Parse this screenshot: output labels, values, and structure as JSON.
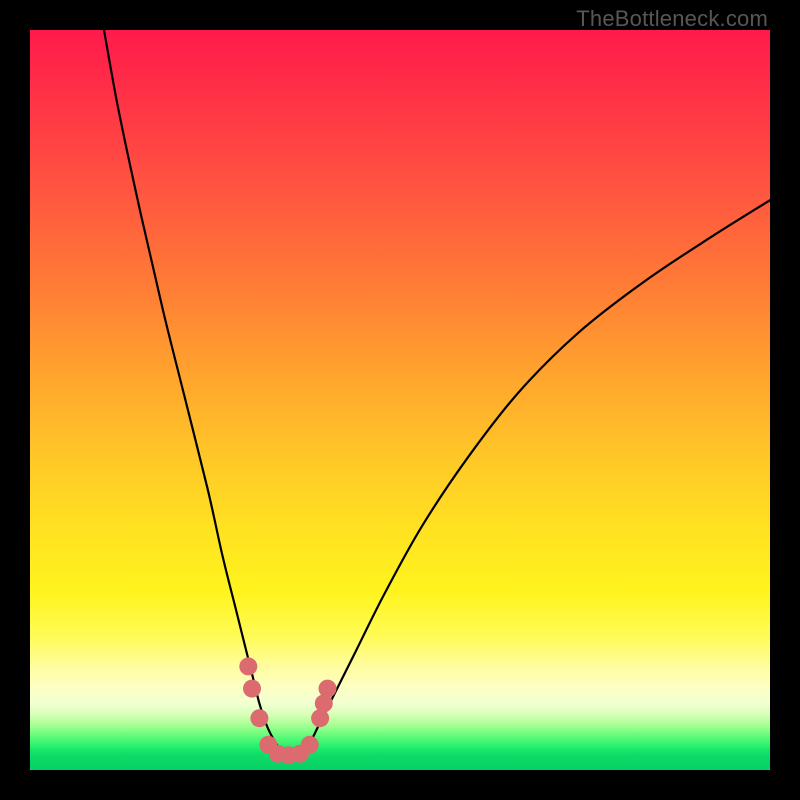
{
  "watermark": "TheBottleneck.com",
  "chart_data": {
    "type": "line",
    "title": "",
    "xlabel": "",
    "ylabel": "",
    "xlim": [
      0,
      100
    ],
    "ylim": [
      0,
      100
    ],
    "series": [
      {
        "name": "curve",
        "x": [
          10,
          12,
          15,
          18,
          21,
          24,
          26,
          28,
          30,
          31,
          32,
          33,
          34,
          35,
          36,
          37,
          38,
          39,
          41,
          44,
          48,
          53,
          59,
          66,
          74,
          83,
          92,
          100
        ],
        "y": [
          100,
          89,
          75,
          62,
          50,
          38,
          29,
          21,
          13,
          9,
          6,
          4,
          2.5,
          2,
          2,
          2.5,
          4,
          6,
          10,
          16,
          24,
          33,
          42,
          51,
          59,
          66,
          72,
          77
        ]
      }
    ],
    "markers": {
      "name": "marker-dots",
      "color": "#db6b6f",
      "points": [
        {
          "x": 29.5,
          "y": 14
        },
        {
          "x": 30.0,
          "y": 11
        },
        {
          "x": 31.0,
          "y": 7
        },
        {
          "x": 32.2,
          "y": 3.4
        },
        {
          "x": 33.5,
          "y": 2.2
        },
        {
          "x": 35.0,
          "y": 2.0
        },
        {
          "x": 36.5,
          "y": 2.2
        },
        {
          "x": 37.8,
          "y": 3.4
        },
        {
          "x": 39.2,
          "y": 7
        },
        {
          "x": 39.7,
          "y": 9
        },
        {
          "x": 40.2,
          "y": 11
        }
      ]
    },
    "gradient_stops": [
      {
        "pos": 0,
        "color": "#ff1a4b"
      },
      {
        "pos": 0.34,
        "color": "#ff7a36"
      },
      {
        "pos": 0.68,
        "color": "#ffe321"
      },
      {
        "pos": 0.89,
        "color": "#fcffc4"
      },
      {
        "pos": 1.0,
        "color": "#06d165"
      }
    ]
  }
}
